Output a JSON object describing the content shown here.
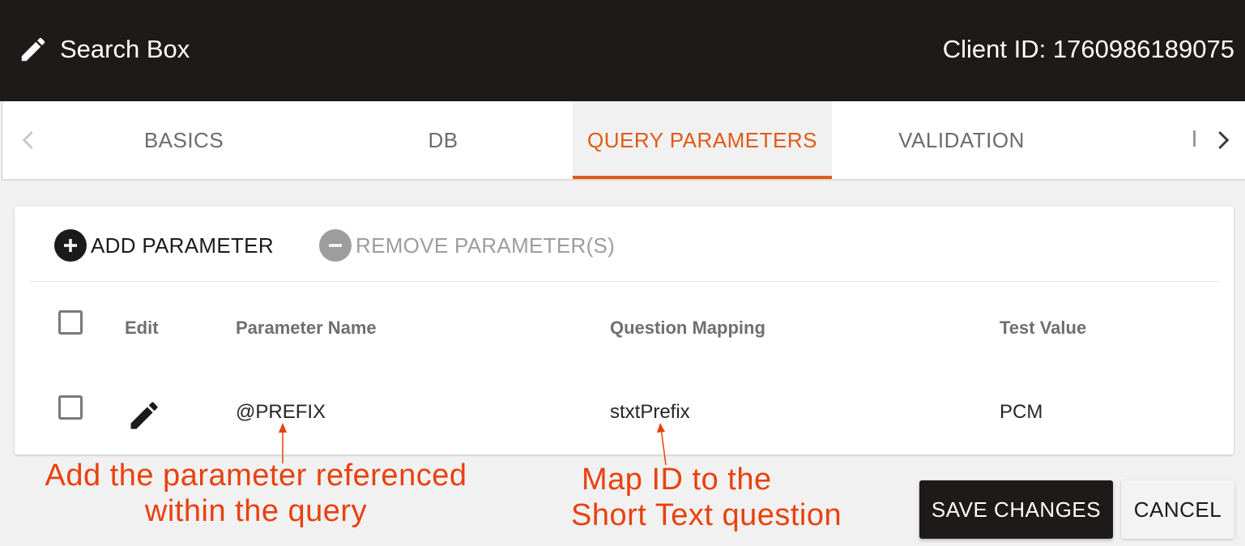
{
  "header": {
    "title": "Search Box",
    "client_id": "Client ID: 1760986189075",
    "background": "#1d1a19"
  },
  "tabs": {
    "items": [
      {
        "label": "BASICS"
      },
      {
        "label": "DB"
      },
      {
        "label": "QUERY PARAMETERS"
      },
      {
        "label": "VALIDATION"
      }
    ],
    "active_index": 2,
    "accent": "#e05a16"
  },
  "toolbar": {
    "add_label": "ADD PARAMETER",
    "remove_label": "REMOVE PARAMETER(S)"
  },
  "table": {
    "columns": [
      "Edit",
      "Parameter Name",
      "Question Mapping",
      "Test Value"
    ],
    "rows": [
      {
        "parameter_name": "@PREFIX",
        "question_mapping": "stxtPrefix",
        "test_value": "PCM"
      }
    ]
  },
  "annotations": {
    "left_line1": "Add the parameter referenced",
    "left_line2": "within the query",
    "right_line1": "Map ID to the",
    "right_line2": "Short Text question",
    "color": "#e8410d"
  },
  "footer": {
    "save_label": "SAVE CHANGES",
    "cancel_label": "CANCEL"
  }
}
